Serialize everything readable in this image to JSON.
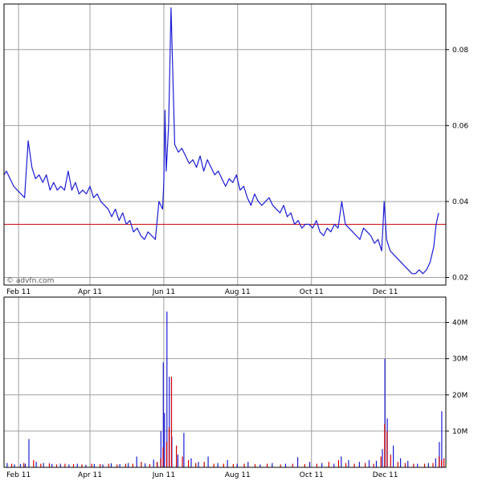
{
  "watermark": "© advfn.com",
  "chart_data": [
    {
      "type": "line",
      "title": "",
      "xlabel": "",
      "ylabel": "",
      "x_range": [
        "2011-01-20",
        "2012-01-20"
      ],
      "ylim": [
        0.018,
        0.092
      ],
      "y_ticks": [
        0.02,
        0.04,
        0.06,
        0.08
      ],
      "y_tick_labels": [
        "0.02",
        "0.04",
        "0.06",
        "0.08"
      ],
      "x_ticks": [
        {
          "date": "2011-02-01",
          "label": "Feb 11"
        },
        {
          "date": "2011-04-01",
          "label": "Apr 11"
        },
        {
          "date": "2011-06-01",
          "label": "Jun 11"
        },
        {
          "date": "2011-08-01",
          "label": "Aug 11"
        },
        {
          "date": "2011-10-01",
          "label": "Oct 11"
        },
        {
          "date": "2011-12-01",
          "label": "Dec 11"
        }
      ],
      "grid": true,
      "line_color": "#1c1cd6",
      "reference_line": {
        "y": 0.034,
        "color": "#cc0000"
      },
      "x": [
        "2011-01-20",
        "2011-01-22",
        "2011-01-25",
        "2011-01-28",
        "2011-01-31",
        "2011-02-03",
        "2011-02-06",
        "2011-02-09",
        "2011-02-12",
        "2011-02-15",
        "2011-02-18",
        "2011-02-21",
        "2011-02-24",
        "2011-02-27",
        "2011-03-02",
        "2011-03-05",
        "2011-03-08",
        "2011-03-11",
        "2011-03-14",
        "2011-03-17",
        "2011-03-20",
        "2011-03-23",
        "2011-03-26",
        "2011-03-29",
        "2011-04-01",
        "2011-04-04",
        "2011-04-07",
        "2011-04-10",
        "2011-04-13",
        "2011-04-16",
        "2011-04-19",
        "2011-04-22",
        "2011-04-25",
        "2011-04-28",
        "2011-05-01",
        "2011-05-04",
        "2011-05-07",
        "2011-05-10",
        "2011-05-13",
        "2011-05-16",
        "2011-05-19",
        "2011-05-22",
        "2011-05-25",
        "2011-05-28",
        "2011-05-31",
        "2011-06-01",
        "2011-06-02",
        "2011-06-03",
        "2011-06-05",
        "2011-06-07",
        "2011-06-10",
        "2011-06-13",
        "2011-06-16",
        "2011-06-19",
        "2011-06-22",
        "2011-06-25",
        "2011-06-28",
        "2011-07-01",
        "2011-07-04",
        "2011-07-07",
        "2011-07-10",
        "2011-07-13",
        "2011-07-16",
        "2011-07-19",
        "2011-07-22",
        "2011-07-25",
        "2011-07-28",
        "2011-07-31",
        "2011-08-03",
        "2011-08-06",
        "2011-08-09",
        "2011-08-12",
        "2011-08-15",
        "2011-08-18",
        "2011-08-21",
        "2011-08-24",
        "2011-08-27",
        "2011-08-30",
        "2011-09-02",
        "2011-09-05",
        "2011-09-08",
        "2011-09-11",
        "2011-09-14",
        "2011-09-17",
        "2011-09-20",
        "2011-09-23",
        "2011-09-26",
        "2011-09-29",
        "2011-10-02",
        "2011-10-05",
        "2011-10-08",
        "2011-10-11",
        "2011-10-14",
        "2011-10-17",
        "2011-10-20",
        "2011-10-23",
        "2011-10-26",
        "2011-10-29",
        "2011-11-01",
        "2011-11-04",
        "2011-11-07",
        "2011-11-10",
        "2011-11-13",
        "2011-11-16",
        "2011-11-19",
        "2011-11-22",
        "2011-11-25",
        "2011-11-28",
        "2011-11-29",
        "2011-11-30",
        "2011-12-02",
        "2011-12-05",
        "2011-12-08",
        "2011-12-11",
        "2011-12-14",
        "2011-12-17",
        "2011-12-20",
        "2011-12-23",
        "2011-12-26",
        "2011-12-29",
        "2012-01-01",
        "2012-01-04",
        "2012-01-07",
        "2012-01-10",
        "2012-01-12",
        "2012-01-14",
        "2012-01-16",
        "2012-01-18"
      ],
      "values": [
        0.047,
        0.048,
        0.046,
        0.044,
        0.043,
        0.042,
        0.041,
        0.056,
        0.049,
        0.046,
        0.047,
        0.045,
        0.047,
        0.043,
        0.045,
        0.043,
        0.044,
        0.043,
        0.048,
        0.043,
        0.045,
        0.042,
        0.043,
        0.042,
        0.044,
        0.041,
        0.042,
        0.04,
        0.039,
        0.038,
        0.036,
        0.038,
        0.035,
        0.037,
        0.034,
        0.035,
        0.032,
        0.033,
        0.031,
        0.03,
        0.032,
        0.031,
        0.03,
        0.04,
        0.038,
        0.045,
        0.064,
        0.048,
        0.06,
        0.091,
        0.055,
        0.053,
        0.054,
        0.052,
        0.05,
        0.051,
        0.049,
        0.052,
        0.048,
        0.051,
        0.049,
        0.047,
        0.048,
        0.046,
        0.044,
        0.046,
        0.045,
        0.047,
        0.043,
        0.044,
        0.041,
        0.039,
        0.042,
        0.04,
        0.039,
        0.04,
        0.041,
        0.039,
        0.038,
        0.037,
        0.039,
        0.036,
        0.037,
        0.034,
        0.035,
        0.033,
        0.034,
        0.034,
        0.033,
        0.035,
        0.032,
        0.031,
        0.033,
        0.032,
        0.034,
        0.033,
        0.04,
        0.034,
        0.033,
        0.032,
        0.031,
        0.03,
        0.033,
        0.032,
        0.031,
        0.029,
        0.03,
        0.027,
        0.033,
        0.04,
        0.03,
        0.027,
        0.026,
        0.025,
        0.024,
        0.023,
        0.022,
        0.021,
        0.021,
        0.022,
        0.021,
        0.022,
        0.024,
        0.028,
        0.034,
        0.037
      ]
    },
    {
      "type": "bar",
      "title": "",
      "xlabel": "",
      "ylabel": "",
      "x_range": [
        "2011-01-20",
        "2012-01-20"
      ],
      "ylim": [
        0,
        47
      ],
      "y_unit": "M",
      "y_ticks": [
        10,
        20,
        30,
        40
      ],
      "y_tick_labels": [
        "10M",
        "20M",
        "30M",
        "40M"
      ],
      "x_ticks": [
        {
          "date": "2011-02-01",
          "label": "Feb 11"
        },
        {
          "date": "2011-04-01",
          "label": "Apr 11"
        },
        {
          "date": "2011-06-01",
          "label": "Jun 11"
        },
        {
          "date": "2011-08-01",
          "label": "Aug 11"
        },
        {
          "date": "2011-10-01",
          "label": "Oct 11"
        },
        {
          "date": "2011-12-01",
          "label": "Dec 11"
        }
      ],
      "grid": true,
      "series": [
        {
          "color": "#1c1cd6",
          "x": [
            "2011-01-23",
            "2011-01-29",
            "2011-02-03",
            "2011-02-07",
            "2011-02-10",
            "2011-02-16",
            "2011-02-22",
            "2011-03-01",
            "2011-03-08",
            "2011-03-15",
            "2011-03-22",
            "2011-03-29",
            "2011-04-05",
            "2011-04-12",
            "2011-04-19",
            "2011-04-26",
            "2011-05-03",
            "2011-05-10",
            "2011-05-17",
            "2011-05-24",
            "2011-05-27",
            "2011-05-30",
            "2011-06-01",
            "2011-06-02",
            "2011-06-04",
            "2011-06-06",
            "2011-06-08",
            "2011-06-13",
            "2011-06-18",
            "2011-06-24",
            "2011-06-30",
            "2011-07-08",
            "2011-07-16",
            "2011-07-24",
            "2011-08-01",
            "2011-08-10",
            "2011-08-20",
            "2011-08-30",
            "2011-09-10",
            "2011-09-20",
            "2011-09-30",
            "2011-10-10",
            "2011-10-20",
            "2011-10-26",
            "2011-11-01",
            "2011-11-10",
            "2011-11-18",
            "2011-11-24",
            "2011-11-29",
            "2011-12-01",
            "2011-12-03",
            "2011-12-08",
            "2011-12-14",
            "2011-12-20",
            "2011-12-28",
            "2012-01-06",
            "2012-01-12",
            "2012-01-15",
            "2012-01-17"
          ],
          "values": [
            1.2,
            0.8,
            0.9,
            1.0,
            7.8,
            1.5,
            1.2,
            0.9,
            1.0,
            0.8,
            1.0,
            0.7,
            0.9,
            0.8,
            1.1,
            0.9,
            1.2,
            3.0,
            1.1,
            2.1,
            1.3,
            10.0,
            29.0,
            15.0,
            43.0,
            25.0,
            8.5,
            3.5,
            9.5,
            2.5,
            1.5,
            3.0,
            1.2,
            2.0,
            1.0,
            1.5,
            0.8,
            1.2,
            1.0,
            2.8,
            1.5,
            1.2,
            1.0,
            3.0,
            2.0,
            1.5,
            2.0,
            1.8,
            5.0,
            30.0,
            13.5,
            6.0,
            2.5,
            1.8,
            1.0,
            1.2,
            2.5,
            7.0,
            15.5
          ]
        },
        {
          "color": "#d60000",
          "x": [
            "2011-01-26",
            "2011-02-05",
            "2011-02-13",
            "2011-02-19",
            "2011-02-26",
            "2011-03-04",
            "2011-03-11",
            "2011-03-18",
            "2011-03-25",
            "2011-04-02",
            "2011-04-09",
            "2011-04-16",
            "2011-04-23",
            "2011-04-30",
            "2011-05-06",
            "2011-05-13",
            "2011-05-20",
            "2011-05-26",
            "2011-05-29",
            "2011-05-31",
            "2011-06-03",
            "2011-06-05",
            "2011-06-07",
            "2011-06-11",
            "2011-06-16",
            "2011-06-21",
            "2011-06-27",
            "2011-07-04",
            "2011-07-12",
            "2011-07-20",
            "2011-07-28",
            "2011-08-06",
            "2011-08-15",
            "2011-08-25",
            "2011-09-05",
            "2011-09-15",
            "2011-09-25",
            "2011-10-05",
            "2011-10-15",
            "2011-10-23",
            "2011-10-29",
            "2011-11-05",
            "2011-11-14",
            "2011-11-21",
            "2011-11-27",
            "2011-11-30",
            "2011-12-02",
            "2011-12-05",
            "2011-12-11",
            "2011-12-17",
            "2011-12-24",
            "2012-01-02",
            "2012-01-09",
            "2012-01-14",
            "2012-01-16",
            "2012-01-18"
          ],
          "values": [
            1.0,
            1.2,
            2.0,
            1.0,
            1.1,
            0.8,
            1.0,
            0.9,
            0.8,
            1.0,
            0.9,
            1.0,
            0.8,
            1.0,
            1.0,
            1.5,
            0.9,
            1.5,
            2.5,
            5.5,
            7.0,
            11.0,
            25.0,
            6.0,
            3.0,
            2.0,
            1.2,
            1.5,
            1.0,
            1.0,
            0.9,
            1.0,
            0.9,
            1.0,
            0.8,
            1.0,
            0.9,
            1.0,
            1.5,
            2.0,
            1.2,
            1.0,
            1.2,
            1.0,
            3.0,
            12.0,
            10.0,
            3.5,
            1.5,
            1.2,
            1.0,
            1.0,
            1.2,
            3.0,
            2.0,
            2.5
          ]
        }
      ]
    }
  ]
}
